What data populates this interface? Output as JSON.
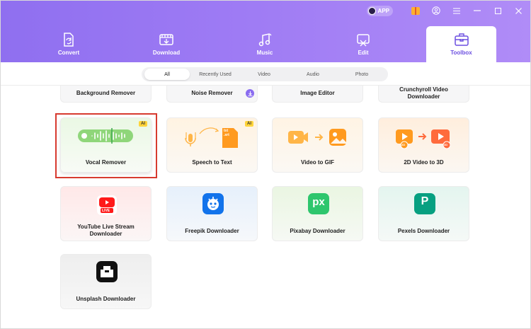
{
  "titlebar": {
    "app_badge": "APP",
    "icons": [
      "gift-icon",
      "user-icon",
      "menu-icon",
      "minimize-icon",
      "maximize-icon",
      "close-icon"
    ]
  },
  "tabs": [
    {
      "label": "Convert",
      "icon": "convert-icon"
    },
    {
      "label": "Download",
      "icon": "download-icon"
    },
    {
      "label": "Music",
      "icon": "music-icon"
    },
    {
      "label": "Edit",
      "icon": "edit-icon"
    },
    {
      "label": "Toolbox",
      "icon": "toolbox-icon",
      "active": true
    }
  ],
  "filters": [
    {
      "label": "All",
      "active": true
    },
    {
      "label": "Recently Used"
    },
    {
      "label": "Video"
    },
    {
      "label": "Audio"
    },
    {
      "label": "Photo"
    }
  ],
  "tools_top_row": [
    "Background Remover",
    "Noise Remover",
    "Image Editor",
    "Crunchyroll Video Downloader"
  ],
  "tools": [
    {
      "label": "Vocal Remover",
      "badge": "AI",
      "selected": true
    },
    {
      "label": "Speech to Text",
      "badge": "AI",
      "file_label": "txt\n.srt"
    },
    {
      "label": "Video to GIF"
    },
    {
      "label": "2D Video to 3D",
      "icon_labels": [
        "2D",
        "3D"
      ]
    },
    {
      "label": "YouTube Live Stream Downloader",
      "icon_label": "LIVE"
    },
    {
      "label": "Freepik Downloader"
    },
    {
      "label": "Pixabay Downloader",
      "icon_label": "px"
    },
    {
      "label": "Pexels Downloader",
      "icon_label": "P"
    },
    {
      "label": "Unsplash Downloader"
    }
  ],
  "colors": {
    "accent": "#8f6ff0",
    "active_tab_text": "#6c4fe0",
    "highlight_border": "#d73a2f",
    "ai_badge": "#ffd43b"
  }
}
